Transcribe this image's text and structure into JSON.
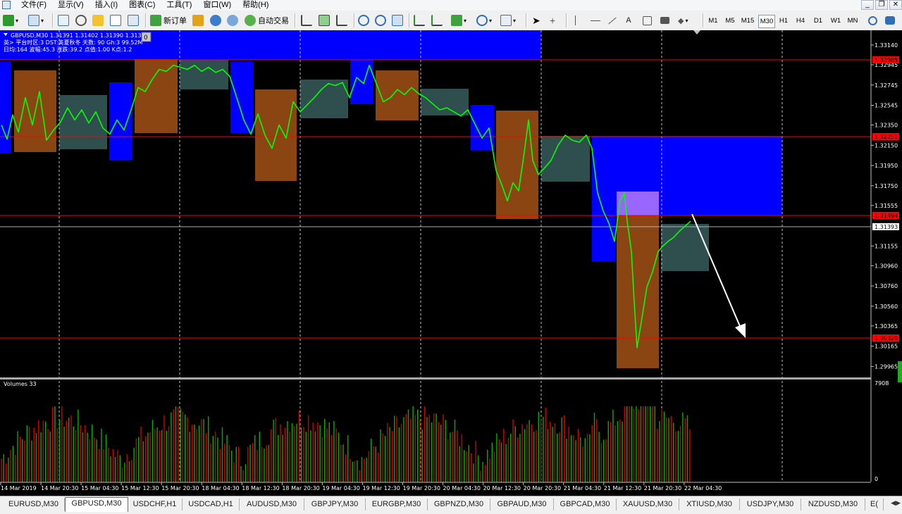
{
  "menu": [
    {
      "label": "文件(F)",
      "name": "menu-file"
    },
    {
      "label": "显示(V)",
      "name": "menu-view"
    },
    {
      "label": "插入(I)",
      "name": "menu-insert"
    },
    {
      "label": "图表(C)",
      "name": "menu-charts"
    },
    {
      "label": "工具(T)",
      "name": "menu-tools"
    },
    {
      "label": "窗口(W)",
      "name": "menu-window"
    },
    {
      "label": "帮助(H)",
      "name": "menu-help"
    }
  ],
  "toolbar": {
    "new_order": "新订单",
    "auto_trading": "自动交易",
    "timeframes": [
      "M1",
      "M5",
      "M15",
      "M30",
      "H1",
      "H4",
      "D1",
      "W1",
      "MN"
    ],
    "active_timeframe": "M30"
  },
  "chart": {
    "symbol_line": "GBPUSD,M30  1.31391 1.31402 1.31390 1.31393",
    "info_line_1": "英> 平台时区:3  DST:英夏秋冬  天数: 90  Gh:3  99.52M",
    "info_line_2": "日均:164  波幅:45.3  涨跌:39.2  点值:1.00  K点:1.2",
    "one_click_badge": "0",
    "volumes_label": "Volumes 33",
    "volume_scale_top": "7908",
    "volume_scale_bottom": "0",
    "current_price": "1.31393",
    "price_ticks": [
      "1.33140",
      "1.32945",
      "1.32745",
      "1.32545",
      "1.32350",
      "1.32150",
      "1.31950",
      "1.31750",
      "1.31555",
      "1.31155",
      "1.30960",
      "1.30760",
      "1.30560",
      "1.30365",
      "1.30165",
      "1.29965"
    ],
    "marked_levels": [
      {
        "label": "1.32985",
        "color": "#ff0000"
      },
      {
        "label": "1.32251",
        "color": "#ff0000"
      },
      {
        "label": "1.31494",
        "color": "#ff0000"
      },
      {
        "label": "1.30320",
        "color": "#ff0000"
      }
    ],
    "time_labels": [
      "14 Mar 2019",
      "14 Mar 20:30",
      "15 Mar 04:30",
      "15 Mar 12:30",
      "15 Mar 20:30",
      "18 Mar 04:30",
      "18 Mar 12:30",
      "18 Mar 20:30",
      "19 Mar 04:30",
      "19 Mar 12:30",
      "19 Mar 20:30",
      "20 Mar 04:30",
      "20 Mar 12:30",
      "20 Mar 20:30",
      "21 Mar 04:30",
      "21 Mar 12:30",
      "21 Mar 20:30",
      "22 Mar 04:30"
    ],
    "colors": {
      "up": "#00ff00",
      "volume_up": "#00b000",
      "volume_down": "#d00000",
      "zone_blue": "#0000ff",
      "zone_brown": "#8b4513",
      "zone_gray": "#2f4f4f",
      "zone_purple": "#9966ff",
      "level_line": "#ff0000",
      "grid": "#c0c0c0"
    }
  },
  "symbol_tabs": [
    {
      "label": "EURUSD,M30",
      "active": false
    },
    {
      "label": "GBPUSD,M30",
      "active": true
    },
    {
      "label": "USDCHF,H1",
      "active": false
    },
    {
      "label": "USDCAD,H1",
      "active": false
    },
    {
      "label": "AUDUSD,M30",
      "active": false
    },
    {
      "label": "GBPJPY,M30",
      "active": false
    },
    {
      "label": "EURGBP,M30",
      "active": false
    },
    {
      "label": "GBPNZD,M30",
      "active": false
    },
    {
      "label": "GBPAUD,M30",
      "active": false
    },
    {
      "label": "GBPCAD,M30",
      "active": false
    },
    {
      "label": "XAUUSD,M30",
      "active": false
    },
    {
      "label": "XTIUSD,M30",
      "active": false
    },
    {
      "label": "USDJPY,M30",
      "active": false
    },
    {
      "label": "NZDUSD,M30",
      "active": false
    },
    {
      "label": "E(",
      "active": false
    }
  ]
}
